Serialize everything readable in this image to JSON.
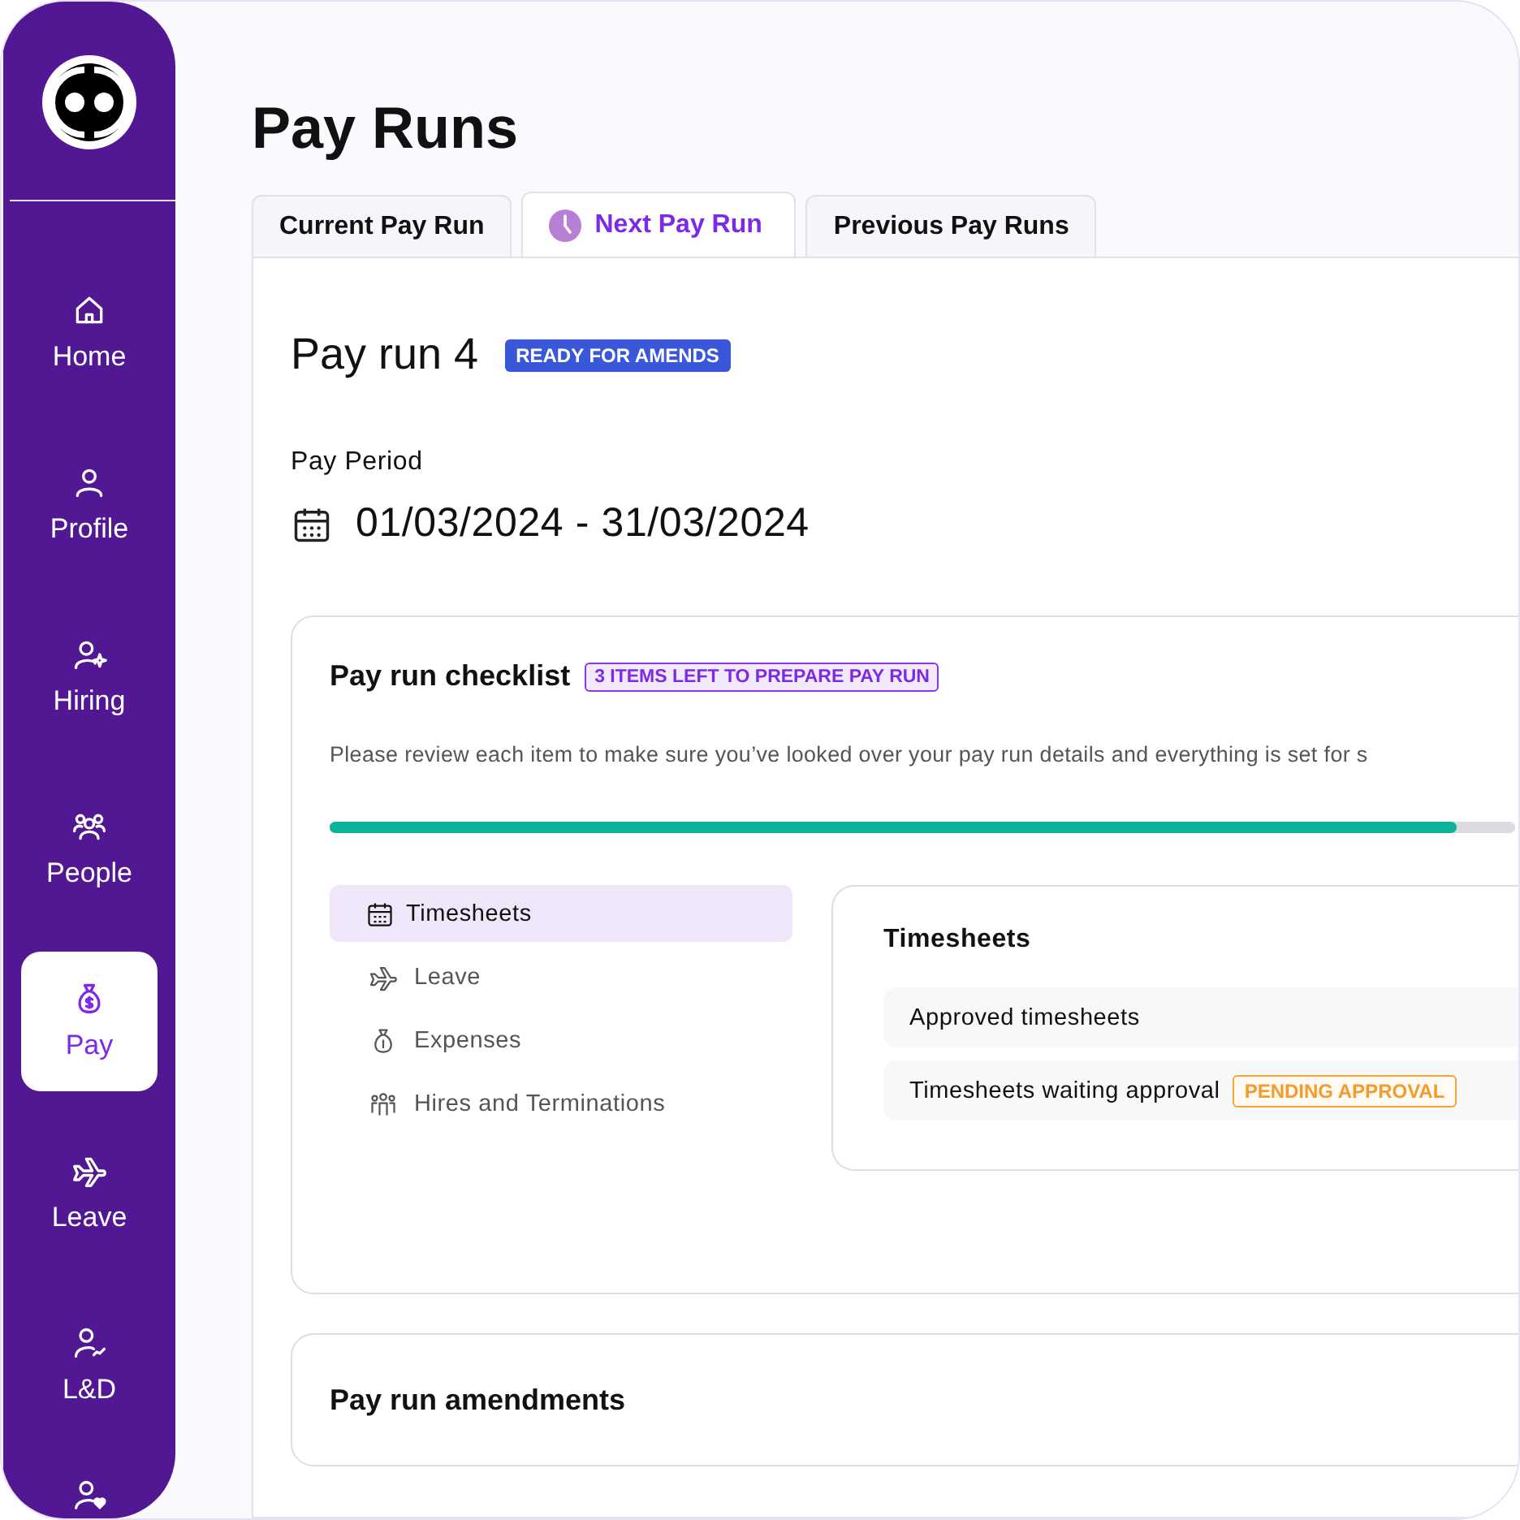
{
  "sidebar": {
    "items": [
      {
        "label": "Home",
        "selected": false
      },
      {
        "label": "Profile",
        "selected": false
      },
      {
        "label": "Hiring",
        "selected": false
      },
      {
        "label": "People",
        "selected": false
      },
      {
        "label": "Pay",
        "selected": true
      },
      {
        "label": "Leave",
        "selected": false
      },
      {
        "label": "L&D",
        "selected": false
      }
    ]
  },
  "page_title": "Pay Runs",
  "tabs": [
    {
      "label": "Current Pay Run",
      "selected": false
    },
    {
      "label": "Next Pay Run",
      "selected": true
    },
    {
      "label": "Previous Pay Runs",
      "selected": false
    }
  ],
  "pay_run": {
    "title": "Pay run 4",
    "status": "READY FOR AMENDS",
    "period_label": "Pay Period",
    "period": "01/03/2024 - 31/03/2024"
  },
  "checklist": {
    "title": "Pay run checklist",
    "badge": "3 ITEMS LEFT TO PREPARE PAY RUN",
    "description": "Please review each item to make sure you’ve looked over your pay run details and everything is set for s",
    "progress": {
      "level": 0.95
    },
    "items": [
      {
        "label": "Timesheets",
        "selected": true
      },
      {
        "label": "Leave",
        "selected": false
      },
      {
        "label": "Expenses",
        "selected": false
      },
      {
        "label": "Hires and Terminations",
        "selected": false
      }
    ],
    "detail": {
      "title": "Timesheets",
      "rows": [
        {
          "label": "Approved timesheets"
        },
        {
          "label": "Timesheets waiting approval",
          "badge": "PENDING APPROVAL"
        }
      ]
    }
  },
  "amendments": {
    "title": "Pay run amendments"
  }
}
